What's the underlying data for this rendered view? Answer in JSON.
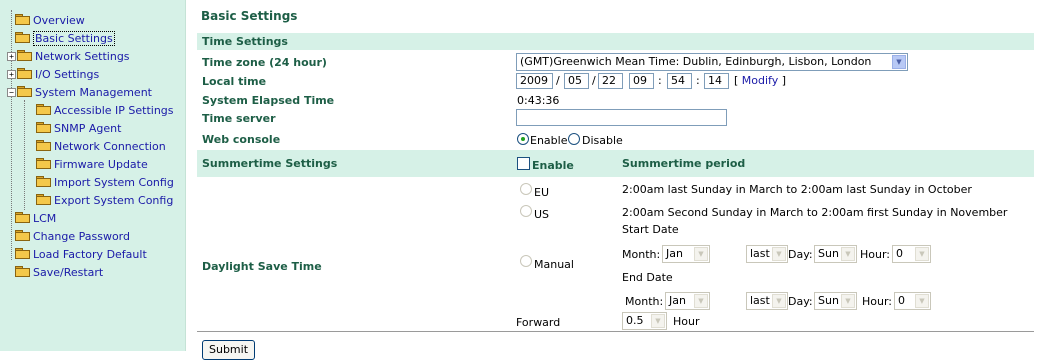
{
  "sidebar": {
    "items": [
      {
        "label": "Overview"
      },
      {
        "label": "Basic Settings"
      },
      {
        "label": "Network Settings"
      },
      {
        "label": "I/O Settings"
      },
      {
        "label": "System Management"
      },
      {
        "label": "Accessible IP Settings"
      },
      {
        "label": "SNMP Agent"
      },
      {
        "label": "Network Connection"
      },
      {
        "label": "Firmware Update"
      },
      {
        "label": "Import System Config"
      },
      {
        "label": "Export System Config"
      },
      {
        "label": "LCM"
      },
      {
        "label": "Change Password"
      },
      {
        "label": "Load Factory Default"
      },
      {
        "label": "Save/Restart"
      }
    ],
    "expander_plus": "+",
    "expander_minus": "−"
  },
  "page": {
    "title": "Basic Settings"
  },
  "time_settings": {
    "header": "Time Settings",
    "timezone_label": "Time zone (24 hour)",
    "timezone_value": "(GMT)Greenwich Mean Time: Dublin, Edinburgh, Lisbon, London",
    "local_time_label": "Local time",
    "year": "2009",
    "month": "05",
    "day": "22",
    "hour": "09",
    "minute": "54",
    "second": "14",
    "date_sep": "/",
    "time_sep": ":",
    "modify_open": "[",
    "modify_link": "Modify",
    "modify_close": "]",
    "elapsed_label": "System Elapsed Time",
    "elapsed_value": "0:43:36",
    "time_server_label": "Time server",
    "time_server_value": "",
    "web_console_label": "Web console",
    "enable_label": "Enable",
    "disable_label": "Disable"
  },
  "summertime": {
    "header": "Summertime Settings",
    "enable_label": "Enable",
    "period_header": "Summertime period",
    "dst_label": "Daylight Save Time",
    "eu_label": "EU",
    "eu_period": "2:00am last Sunday in March to 2:00am last Sunday in October",
    "us_label": "US",
    "us_period": "2:00am Second Sunday in March to 2:00am first Sunday in November",
    "manual_label": "Manual",
    "start_date_label": "Start Date",
    "end_date_label": "End Date",
    "month_label": "Month:",
    "day_label": "Day:",
    "hour_label": "Hour:",
    "start_month": "Jan",
    "start_week": "last",
    "start_day": "Sun",
    "start_hour": "0",
    "end_month": "Jan",
    "end_week": "last",
    "end_day": "Sun",
    "end_hour": "0",
    "forward_label": "Forward",
    "forward_value": "0.5",
    "forward_unit": "Hour"
  },
  "submit_label": "Submit"
}
